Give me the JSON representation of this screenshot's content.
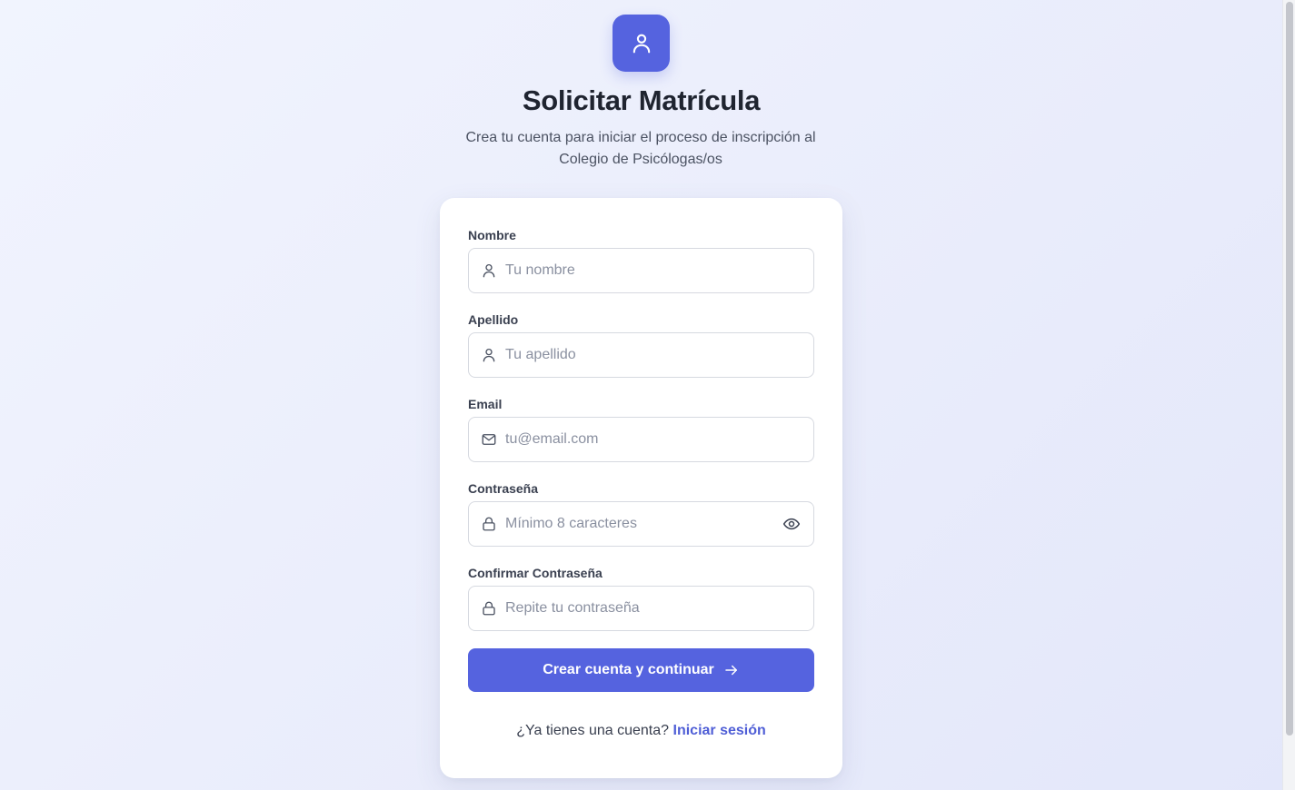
{
  "header": {
    "title": "Solicitar Matrícula",
    "subtitle": "Crea tu cuenta para iniciar el proceso de inscripción al Colegio de Psicólogas/os",
    "logo_icon": "user-icon"
  },
  "form": {
    "fields": [
      {
        "label": "Nombre",
        "placeholder": "Tu nombre",
        "value": "",
        "icon": "user-icon"
      },
      {
        "label": "Apellido",
        "placeholder": "Tu apellido",
        "value": "",
        "icon": "user-icon"
      },
      {
        "label": "Email",
        "placeholder": "tu@email.com",
        "value": "",
        "icon": "mail-icon"
      },
      {
        "label": "Contraseña",
        "placeholder": "Mínimo 8 caracteres",
        "value": "",
        "icon": "lock-icon",
        "toggle_icon": "eye-icon"
      },
      {
        "label": "Confirmar Contraseña",
        "placeholder": "Repite tu contraseña",
        "value": "",
        "icon": "lock-icon"
      }
    ],
    "submit_label": "Crear cuenta y continuar",
    "submit_icon": "arrow-right-icon"
  },
  "footer": {
    "prompt": "¿Ya tienes una cuenta?",
    "login_link": "Iniciar sesión"
  },
  "colors": {
    "accent": "#5563df",
    "link": "#4f5ed6",
    "text": "#1f2430",
    "muted": "#4b5262"
  }
}
